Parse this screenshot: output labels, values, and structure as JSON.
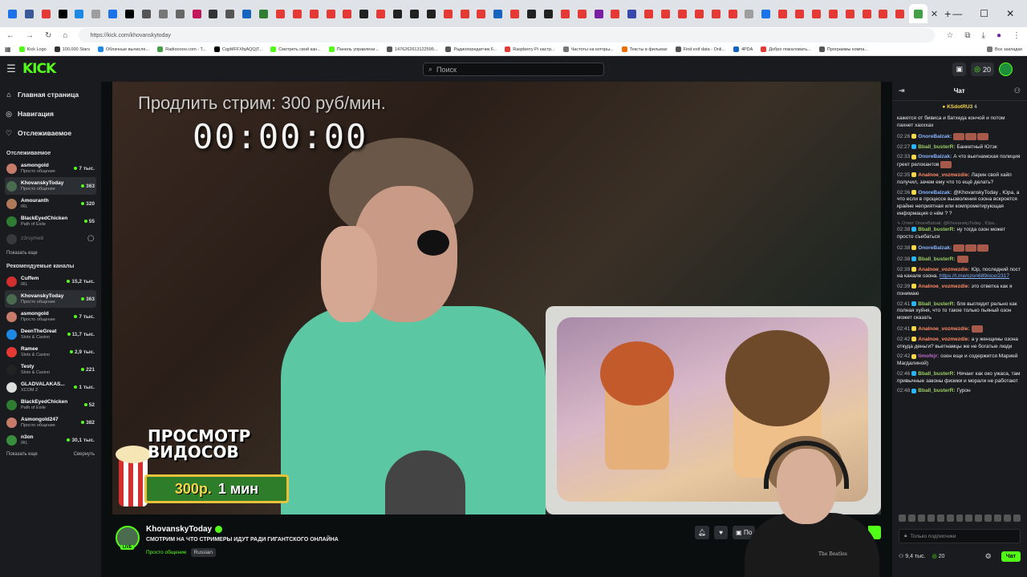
{
  "browser": {
    "url": "https://kick.com/khovanskytoday",
    "tab_colors": [
      "#1a73e8",
      "#3b5998",
      "#e53935",
      "#000000",
      "#1e88e5",
      "#9e9e9e",
      "#1a73e8",
      "#000000",
      "#555555",
      "#777777",
      "#666666",
      "#c2185b",
      "#333333",
      "#555555",
      "#1565c0",
      "#2e7d32",
      "#e53935",
      "#e53935",
      "#e53935",
      "#e53935",
      "#e53935",
      "#212121",
      "#e53935",
      "#212121",
      "#212121",
      "#212121",
      "#e53935",
      "#e53935",
      "#e53935",
      "#1565c0",
      "#e53935",
      "#212121",
      "#212121",
      "#e53935",
      "#e53935",
      "#7b1fa2",
      "#e53935",
      "#3949ab",
      "#e53935",
      "#e53935",
      "#e53935",
      "#e53935",
      "#e53935",
      "#e53935",
      "#9e9e9e",
      "#1a73e8",
      "#e53935",
      "#e53935",
      "#e53935",
      "#e53935",
      "#e53935",
      "#e53935",
      "#e53935",
      "#e53935",
      "#43a047"
    ],
    "bookmarks": [
      {
        "label": "Kick Logo",
        "color": "#53fc18"
      },
      {
        "label": "100,000 Stars",
        "color": "#333333"
      },
      {
        "label": "Облачные вычисле...",
        "color": "#1e88e5"
      },
      {
        "label": "Radiooooo.com - T...",
        "color": "#43a047"
      },
      {
        "label": "CqpMFFXfqAQQjT...",
        "color": "#000000"
      },
      {
        "label": "Смотреть свой кан...",
        "color": "#53fc18"
      },
      {
        "label": "Панель управлени...",
        "color": "#53fc18"
      },
      {
        "label": "1476262613122595...",
        "color": "#555555"
      },
      {
        "label": "Радиопередатчик F...",
        "color": "#555555"
      },
      {
        "label": "Raspberry Pi настр...",
        "color": "#e53935"
      },
      {
        "label": "Частоты на которы...",
        "color": "#777777"
      },
      {
        "label": "Тексты в фильмах",
        "color": "#ef6c00"
      },
      {
        "label": "Find exif data - Onli...",
        "color": "#555555"
      },
      {
        "label": "4PDA",
        "color": "#1565c0"
      },
      {
        "label": "Добро пожаловать...",
        "color": "#e53935"
      },
      {
        "label": "Программы компа...",
        "color": "#555555"
      },
      {
        "label": "Все закладки",
        "color": "#777777"
      }
    ]
  },
  "kick": {
    "logo": "KICK",
    "search_placeholder": "Поиск",
    "top_count": "20",
    "sidebar": {
      "nav": [
        {
          "label": "Главная страница",
          "icon": "home-icon",
          "glyph": "⌂"
        },
        {
          "label": "Навигация",
          "icon": "compass-icon",
          "glyph": "◎"
        },
        {
          "label": "Отслеживаемое",
          "icon": "heart-icon",
          "glyph": "♡"
        }
      ],
      "followed_heading": "Отслеживаемое",
      "followed": [
        {
          "name": "asmongold",
          "category": "Просто общение",
          "viewers": "7 тыс.",
          "color": "#c77b6b",
          "selected": false,
          "offline": false
        },
        {
          "name": "KhovanskyToday",
          "category": "Просто общение",
          "viewers": "363",
          "color": "#4b6b4f",
          "selected": true,
          "offline": false
        },
        {
          "name": "Amouranth",
          "category": "IRL",
          "viewers": "320",
          "color": "#b07a5a",
          "selected": false,
          "offline": false
        },
        {
          "name": "BlackEyedChicken",
          "category": "Path of Exile",
          "viewers": "55",
          "color": "#2e7d32",
          "selected": false,
          "offline": false
        },
        {
          "name": "z3rsyme8",
          "category": "",
          "viewers": "",
          "color": "#555555",
          "selected": false,
          "offline": true
        }
      ],
      "show_more": "Показать еще",
      "recommended_heading": "Рекомендуемые каналы",
      "recommended": [
        {
          "name": "Cuffem",
          "category": "IRL",
          "viewers": "15,2 тыс.",
          "color": "#d32f2f",
          "selected": false
        },
        {
          "name": "KhovanskyToday",
          "category": "Просто общение",
          "viewers": "363",
          "color": "#4b6b4f",
          "selected": true
        },
        {
          "name": "asmongold",
          "category": "Просто общение",
          "viewers": "7 тыс.",
          "color": "#c77b6b",
          "selected": false
        },
        {
          "name": "DeenTheGreat",
          "category": "Slots & Casino",
          "viewers": "11,7 тыс.",
          "color": "#1e88e5",
          "selected": false
        },
        {
          "name": "Ramee",
          "category": "Slots & Casino",
          "viewers": "2,9 тыс.",
          "color": "#e53935",
          "selected": false
        },
        {
          "name": "Testy",
          "category": "Slots & Casino",
          "viewers": "221",
          "color": "#222222",
          "selected": false
        },
        {
          "name": "GLADVALAKAS...",
          "category": "XCOM 2",
          "viewers": "1 тыс.",
          "color": "#dddddd",
          "selected": false
        },
        {
          "name": "BlackEyedChicken",
          "category": "Path of Exile",
          "viewers": "52",
          "color": "#2e7d32",
          "selected": false
        },
        {
          "name": "Asmongold247",
          "category": "Просто общение",
          "viewers": "382",
          "color": "#c77b6b",
          "selected": false
        },
        {
          "name": "n3on",
          "category": "IRL",
          "viewers": "30,1 тыс.",
          "color": "#388e3c",
          "selected": false
        }
      ],
      "show_more_2": "Показать еще",
      "collapse": "Свернуть"
    },
    "video": {
      "overlay_text": "Продлить стрим: 300 руб/мин.",
      "timer": "00:00:00",
      "promo_line1": "ПРОСМОТР",
      "promo_line2": "ВИДОСОВ",
      "promo_price": "300р.",
      "promo_duration": "1 мин",
      "popcorn_label": "POP CORN",
      "shirt_text": "The Beatles"
    },
    "stream": {
      "channel": "KhovanskyToday",
      "title": "СМОТРИМ НА ЧТО СТРИМЕРЫ ИДУТ РАДИ ГИГАНТСКОГО ОНЛАЙНА",
      "category": "Просто общение",
      "language": "Russian",
      "live": "LIVE",
      "subscribe_short": "По"
    },
    "chat": {
      "title": "Чат",
      "pinned_user": "KSdotRU3",
      "pinned_count": "4",
      "messages": [
        {
          "time": "",
          "user": "",
          "color": "#ffffff",
          "text": "кажется от бивиса и батхеда кончой и потом пахнет хахххах"
        },
        {
          "time": "02:26",
          "user": "OnoreBalzak:",
          "color": "#8ab4ff",
          "text": "",
          "emotes": 3
        },
        {
          "time": "02:27",
          "user": "Bball_busterR:",
          "color": "#9ccc65",
          "text": "Банкетный Ютэк"
        },
        {
          "time": "02:33",
          "user": "OnoreBalzak:",
          "color": "#8ab4ff",
          "text": "А что вьетнамская полиция греет релокантов",
          "emotes": 1
        },
        {
          "time": "02:35",
          "user": "Analnoe_vozmezdie:",
          "color": "#ff8a65",
          "text": "Ларин свой хайп получил, зачем ему что то ещё делать?"
        },
        {
          "time": "02:36",
          "user": "OnoreBalzak:",
          "color": "#8ab4ff",
          "text": "@KhovanskyToday , Юра, а что если в процессе вызволения озона вскроется крайне неприятная или компрометирующая информация о нём ? ?"
        },
        {
          "time": "02:38",
          "user": "Bball_busterR:",
          "color": "#9ccc65",
          "text": "ну тогда озон может просто съебаться",
          "reply": "Ответ OnoreBalzak: @KhovanskyToday , Юра..."
        },
        {
          "time": "02:38",
          "user": "OnoreBalzak:",
          "color": "#8ab4ff",
          "text": "",
          "emotes": 3
        },
        {
          "time": "02:38",
          "user": "Bball_busterR:",
          "color": "#9ccc65",
          "text": "",
          "emotes": 1
        },
        {
          "time": "02:39",
          "user": "Analnoe_vozmezdie:",
          "color": "#ff8a65",
          "text": "Юр, последний пост на канале озона.",
          "link": "https://t.me/ozon689nice/2317"
        },
        {
          "time": "02:39",
          "user": "Analnoe_vozmezdie:",
          "color": "#ff8a65",
          "text": "это ответка как я понимаю"
        },
        {
          "time": "02:41",
          "user": "Bball_busterR:",
          "color": "#9ccc65",
          "text": "бля выглядит рельно как полная хуйня, что то такое только пьяный озон может сказать"
        },
        {
          "time": "02:41",
          "user": "Analnoe_vozmezdie:",
          "color": "#ff8a65",
          "text": "",
          "emotes": 1
        },
        {
          "time": "02:42",
          "user": "Analnoe_vozmezdie:",
          "color": "#ff8a65",
          "text": "а у женщины озона откуда деньги? вьетнамцы же не богатые люди"
        },
        {
          "time": "02:42",
          "user": "timofejr:",
          "color": "#ba68c8",
          "text": "озон еще и содержится Марией Магдалиной)"
        },
        {
          "time": "02:46",
          "user": "Bball_busterR:",
          "color": "#9ccc65",
          "text": "Нячанг как око ужаса, там привычные законы физики и морали не работают"
        },
        {
          "time": "02:48",
          "user": "Bball_busterR:",
          "color": "#9ccc65",
          "text": "Гурон"
        }
      ],
      "input_placeholder": "Только подписчики",
      "viewers": "9,4 тыс.",
      "points": "20",
      "send_label": "Чат"
    }
  }
}
